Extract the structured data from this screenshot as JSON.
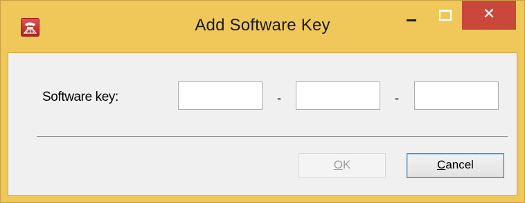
{
  "window": {
    "title": "Add Software Key",
    "close_glyph": "✕",
    "controls": [
      "minimize-icon",
      "maximize-icon",
      "close-icon"
    ],
    "title_bar_color": "#f0c85a",
    "close_button_color": "#c9483b"
  },
  "form": {
    "label": "Software key:",
    "key_parts": [
      {
        "value": ""
      },
      {
        "value": ""
      },
      {
        "value": ""
      }
    ],
    "separator": "-"
  },
  "buttons": {
    "ok": {
      "mnemonic": "O",
      "rest": "K",
      "enabled": false
    },
    "cancel": {
      "mnemonic": "C",
      "rest": "ancel",
      "enabled": true
    }
  }
}
